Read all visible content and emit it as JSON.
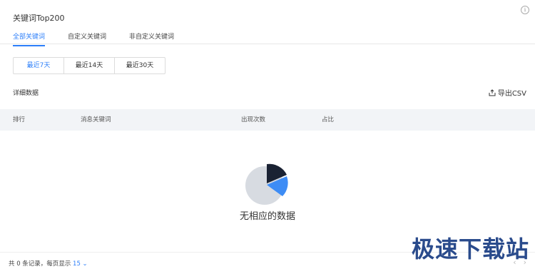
{
  "header": {
    "title": "关键词Top200",
    "info_icon": "info-icon"
  },
  "tabs": [
    {
      "label": "全部关键词",
      "active": true
    },
    {
      "label": "自定义关键词",
      "active": false
    },
    {
      "label": "非自定义关键词",
      "active": false
    }
  ],
  "range": {
    "options": [
      {
        "label": "最近7天",
        "active": true
      },
      {
        "label": "最近14天",
        "active": false
      },
      {
        "label": "最近30天",
        "active": false
      }
    ]
  },
  "section": {
    "label": "详细数据",
    "export_label": "导出CSV"
  },
  "table": {
    "columns": [
      "排行",
      "消息关键词",
      "出现次数",
      "占比"
    ],
    "rows": []
  },
  "empty": {
    "text": "无相应的数据"
  },
  "footer": {
    "prefix": "共 0 条记录，每页显示",
    "page_size": "15"
  },
  "watermark": {
    "text": "极速下载站"
  },
  "colors": {
    "accent": "#2d7ff9",
    "header_bg": "#f2f4f7"
  }
}
